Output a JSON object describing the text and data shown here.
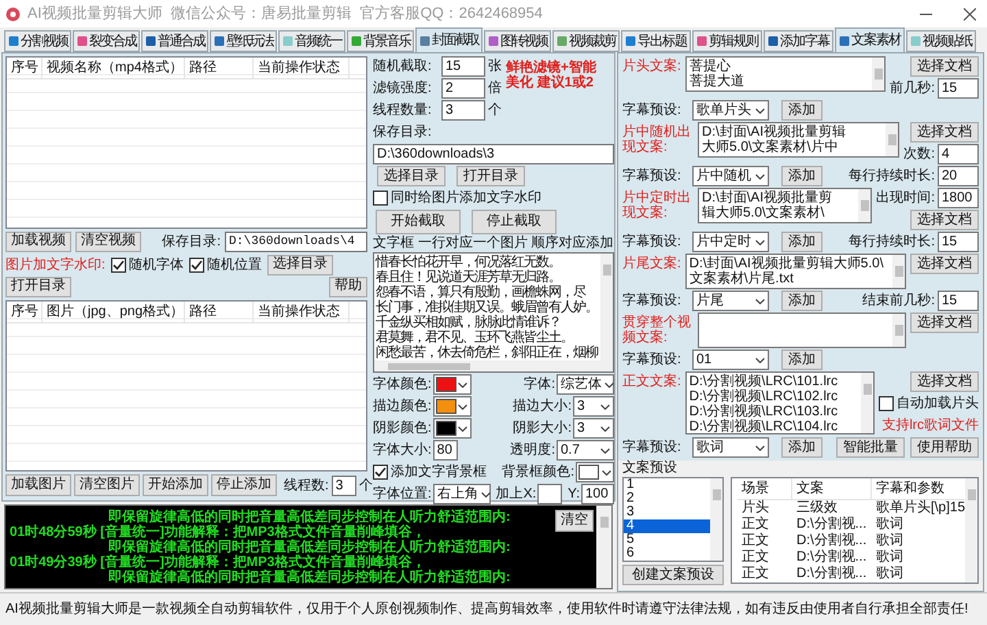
{
  "window": {
    "title": "AI视频批量剪辑大师  微信公众号：唐易批量剪辑  官方客服QQ：2642468954"
  },
  "left_tabs": [
    {
      "label": "分割视频",
      "selected": false
    },
    {
      "label": "裂变合成",
      "selected": false
    },
    {
      "label": "普通合成",
      "selected": false
    },
    {
      "label": "壁纸玩法",
      "selected": false
    },
    {
      "label": "音频统一",
      "selected": false
    },
    {
      "label": "背景音乐",
      "selected": false
    },
    {
      "label": "封面截取",
      "selected": true
    },
    {
      "label": "图转视频",
      "selected": false
    },
    {
      "label": "视频裁剪",
      "selected": false
    }
  ],
  "video_table": {
    "columns": [
      "序号",
      "视频名称（mp4格式）",
      "路径",
      "当前操作状态"
    ]
  },
  "video_buttons": [
    "加载视频",
    "清空视频"
  ],
  "video_save_dir": {
    "label": "保存目录:",
    "value": "D:\\360downloads\\4"
  },
  "watermark": {
    "label": "图片加文字水印:",
    "options": [
      {
        "label": "随机字体",
        "checked": true
      },
      {
        "label": "随机位置",
        "checked": true
      }
    ],
    "buttons": [
      "选择目录",
      "打开目录",
      "帮助"
    ]
  },
  "image_table": {
    "columns": [
      "序号",
      "图片（jpg、png格式）",
      "路径",
      "当前操作状态"
    ]
  },
  "image_buttons": [
    "加载图片",
    "清空图片",
    "开始添加",
    "停止添加"
  ],
  "threads": {
    "label": "线程数:",
    "value": "3",
    "unit": "个"
  },
  "cover": {
    "fields": [
      {
        "label": "随机截取:",
        "value": "15",
        "unit": "张"
      },
      {
        "label": "滤镜强度:",
        "value": "2",
        "unit": "倍"
      },
      {
        "label": "线程数量:",
        "value": "3",
        "unit": "个"
      }
    ],
    "note": "鲜艳滤镜+智能美化 建议1或2",
    "save_dir_label": "保存目录:",
    "save_dir": "D:\\360downloads\\3",
    "dir_buttons": [
      "选择目录",
      "打开目录"
    ],
    "add_watermark": {
      "label": "同时给图片添加文字水印",
      "checked": false
    },
    "actions": [
      "开始截取",
      "停止截取"
    ],
    "text_box_label": "文字框 一行对应一个图片 顺序对应添加",
    "text_box_lines": [
      "惜春长怕花开早，何况落红无数。",
      "春且住！见说道天涯芳草无归路。",
      "怨春不语，算只有殷勤，画檐蛛网，尽",
      "长门事，准拟佳期又误。蛾眉曾有人妒。",
      "千金纵买相如赋，脉脉此情谁诉？",
      "君莫舞，君不见、玉环飞燕皆尘土。",
      "闲愁最苦，休去倚危栏，斜阳正在，烟柳"
    ],
    "style_rows": [
      [
        {
          "kind": "color",
          "label": "字体颜色:",
          "color": "#ee1111"
        },
        {
          "kind": "select",
          "label": "字体:",
          "value": "综艺体"
        }
      ],
      [
        {
          "kind": "color",
          "label": "描边颜色:",
          "color": "#f39010"
        },
        {
          "kind": "select",
          "label": "描边大小:",
          "value": "3"
        }
      ],
      [
        {
          "kind": "color",
          "label": "阴影颜色:",
          "color": "#000000"
        },
        {
          "kind": "select",
          "label": "阴影大小:",
          "value": "3"
        }
      ],
      [
        {
          "kind": "field",
          "label": "字体大小:",
          "value": "80"
        },
        {
          "kind": "select",
          "label": "透明度:",
          "value": "0.7"
        }
      ],
      [
        {
          "kind": "checkbox",
          "label": "添加文字背景框",
          "checked": true
        },
        {
          "kind": "color",
          "label": "背景框颜色:",
          "color": "#ffffff"
        }
      ],
      [
        {
          "kind": "select",
          "label": "字体位置:",
          "value": "右上角"
        },
        {
          "kind": "field",
          "label": "加上X:"
        },
        {
          "kind": "field",
          "label": "Y:",
          "value": "100"
        }
      ]
    ]
  },
  "log": {
    "clear_button": "清空",
    "lines": [
      {
        "text": "即保留旋律高低的同时把音量高低差同步控制在人听力舒适范围内:"
      },
      {
        "time": "01时48分59秒",
        "text": "[音量统一]功能解释：把MP3格式文件音量削峰填谷，"
      },
      {
        "text": "即保留旋律高低的同时把音量高低差同步控制在人听力舒适范围内:"
      },
      {
        "time": "01时49分39秒",
        "text": "[音量统一]功能解释：把MP3格式文件音量削峰填谷，"
      },
      {
        "text": "即保留旋律高低的同时把音量高低差同步控制在人听力舒适范围内:"
      }
    ]
  },
  "right_tabs": [
    {
      "label": "导出标题",
      "selected": false
    },
    {
      "label": "剪辑规则",
      "selected": false
    },
    {
      "label": "添加字幕",
      "selected": false
    },
    {
      "label": "文案素材",
      "selected": true
    },
    {
      "label": "视频贴纸",
      "selected": false
    }
  ],
  "copy_rows": [
    {
      "kind": "doc",
      "label": "片头文案:",
      "lines": [
        "菩提心",
        "菩提大道"
      ],
      "side": [
        {
          "kind": "button",
          "label": "选择文档"
        },
        {
          "kind": "field",
          "label": "前几秒:",
          "value": "15"
        }
      ]
    },
    {
      "kind": "preset",
      "label": "字幕预设:",
      "value": "歌单片头",
      "button": "添加"
    },
    {
      "kind": "doc",
      "label": "片中随机出现文案:",
      "lines": [
        "D:\\封面\\AI视频批量剪辑",
        "大师5.0\\文案素材\\片中"
      ],
      "side": [
        {
          "kind": "button",
          "label": "选择文档"
        },
        {
          "kind": "field",
          "label": "次数:",
          "value": "4"
        }
      ]
    },
    {
      "kind": "preset",
      "label": "字幕预设:",
      "value": "片中随机",
      "button": "添加",
      "extras": [
        {
          "kind": "field",
          "label": "每行持续时长:",
          "value": "20"
        }
      ]
    },
    {
      "kind": "doc",
      "label": "片中定时出现文案:",
      "lines": [
        "D:\\封面\\AI视频批量剪",
        "辑大师5.0\\文案素材\\"
      ],
      "side": [
        {
          "kind": "field",
          "label": "出现时间:",
          "value": "1800"
        },
        {
          "kind": "button",
          "label": "选择文档"
        }
      ]
    },
    {
      "kind": "preset",
      "label": "字幕预设:",
      "value": "片中定时",
      "button": "添加",
      "extras": [
        {
          "kind": "field",
          "label": "每行持续时长:",
          "value": "15"
        }
      ]
    },
    {
      "kind": "doc",
      "label": "片尾文案:",
      "lines": [
        "D:\\封面\\AI视频批量剪辑大师5.0\\",
        "文案素材\\片尾.txt"
      ],
      "side": [
        {
          "kind": "button",
          "label": "选择文档"
        }
      ]
    },
    {
      "kind": "preset",
      "label": "字幕预设:",
      "value": "片尾",
      "button": "添加",
      "extras": [
        {
          "kind": "field",
          "label": "结束前几秒:",
          "value": "15"
        }
      ]
    },
    {
      "kind": "doc",
      "label": "贯穿整个视频文案:",
      "side": [
        {
          "kind": "button",
          "label": "选择文档"
        }
      ]
    },
    {
      "kind": "preset",
      "label": "字幕预设:",
      "value": "01",
      "button": "添加"
    },
    {
      "kind": "doc",
      "label": "正文文案:",
      "lines": [
        "D:\\分割视频\\LRC\\101.lrc",
        "D:\\分割视频\\LRC\\102.lrc",
        "D:\\分割视频\\LRC\\103.lrc",
        "D:\\分割视频\\LRC\\104.lrc"
      ],
      "side": [
        {
          "kind": "button",
          "label": "选择文档"
        },
        {
          "kind": "checkbox",
          "label": "自动加载片头",
          "checked": false
        },
        {
          "kind": "note",
          "text": "支持lrc歌词文件"
        }
      ]
    },
    {
      "kind": "preset",
      "label": "字幕预设:",
      "value": "歌词",
      "button": "添加",
      "extras": [
        {
          "kind": "button",
          "label": "智能批量"
        },
        {
          "kind": "button",
          "label": "使用帮助"
        }
      ]
    }
  ],
  "presets": {
    "label": "文案预设",
    "items": [
      {
        "label": "1",
        "selected": false
      },
      {
        "label": "2",
        "selected": false
      },
      {
        "label": "3",
        "selected": false
      },
      {
        "label": "4",
        "selected": true
      },
      {
        "label": "5",
        "selected": false
      },
      {
        "label": "6",
        "selected": false
      }
    ],
    "create_button": "创建文案预设",
    "table": {
      "columns": [
        "场景",
        "文案",
        "字幕和参数"
      ],
      "rows": [
        [
          "片头",
          "三级效",
          "歌单片头[\\p]15"
        ],
        [
          "正文",
          "D:\\分割视...",
          "歌词"
        ],
        [
          "正文",
          "D:\\分割视...",
          "歌词"
        ],
        [
          "正文",
          "D:\\分割视...",
          "歌词"
        ],
        [
          "正文",
          "D:\\分割视...",
          "歌词"
        ]
      ]
    }
  },
  "status_bar": "AI视频批量剪辑大师是一款视频全自动剪辑软件，仅用于个人原创视频制作、提高剪辑效率，使用软件时请遵守法律法规，如有违反由使用者自行承担全部责任!"
}
